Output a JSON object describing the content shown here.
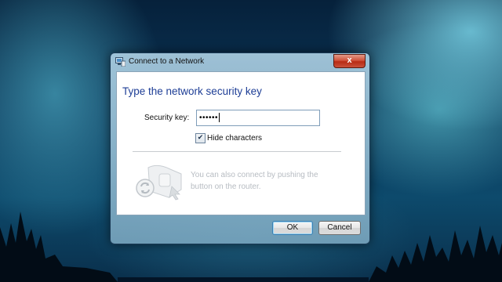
{
  "window": {
    "title": "Connect to a Network",
    "close_label": "x"
  },
  "dialog": {
    "heading": "Type the network security key",
    "security_key_label": "Security key:",
    "security_key_value": "••••••",
    "hide_characters_label": "Hide characters",
    "hide_characters_checked": true,
    "push_button_text": "You can also connect by pushing the button on the router."
  },
  "buttons": {
    "ok_label": "OK",
    "cancel_label": "Cancel"
  },
  "colors": {
    "heading": "#1e3e96",
    "close_button": "#c9503a"
  },
  "icons": {
    "title": "network-icon",
    "router": "router-push-button-icon",
    "checkbox": "checkmark-icon"
  }
}
